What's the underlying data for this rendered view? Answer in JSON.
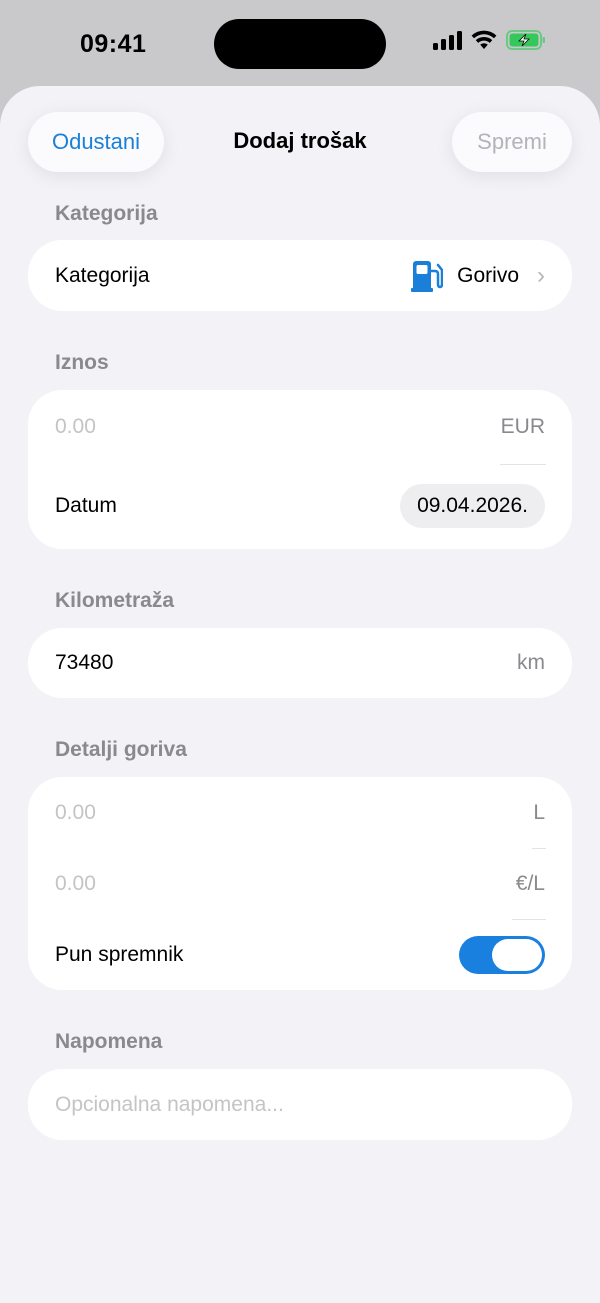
{
  "status_bar": {
    "time": "09:41"
  },
  "header": {
    "cancel_label": "Odustani",
    "title": "Dodaj trošak",
    "save_label": "Spremi"
  },
  "category_section": {
    "header": "Kategorija",
    "row_label": "Kategorija",
    "value": "Gorivo",
    "icon": "fuel-pump-icon"
  },
  "amount_section": {
    "header": "Iznos",
    "amount_placeholder": "0.00",
    "currency": "EUR",
    "date_label": "Datum",
    "date_value": "09.04.2026."
  },
  "mileage_section": {
    "header": "Kilometraža",
    "value": "73480",
    "unit": "km"
  },
  "fuel_section": {
    "header": "Detalji goriva",
    "liters_placeholder": "0.00",
    "liters_unit": "L",
    "price_placeholder": "0.00",
    "price_unit": "€/L",
    "full_tank_label": "Pun spremnik",
    "full_tank_on": true
  },
  "note_section": {
    "header": "Napomena",
    "placeholder": "Opcionalna napomena..."
  },
  "colors": {
    "accent": "#1a7fd9",
    "toggle_on": "#1a80e0",
    "battery_green": "#34c759",
    "background": "#f2f2f7"
  }
}
